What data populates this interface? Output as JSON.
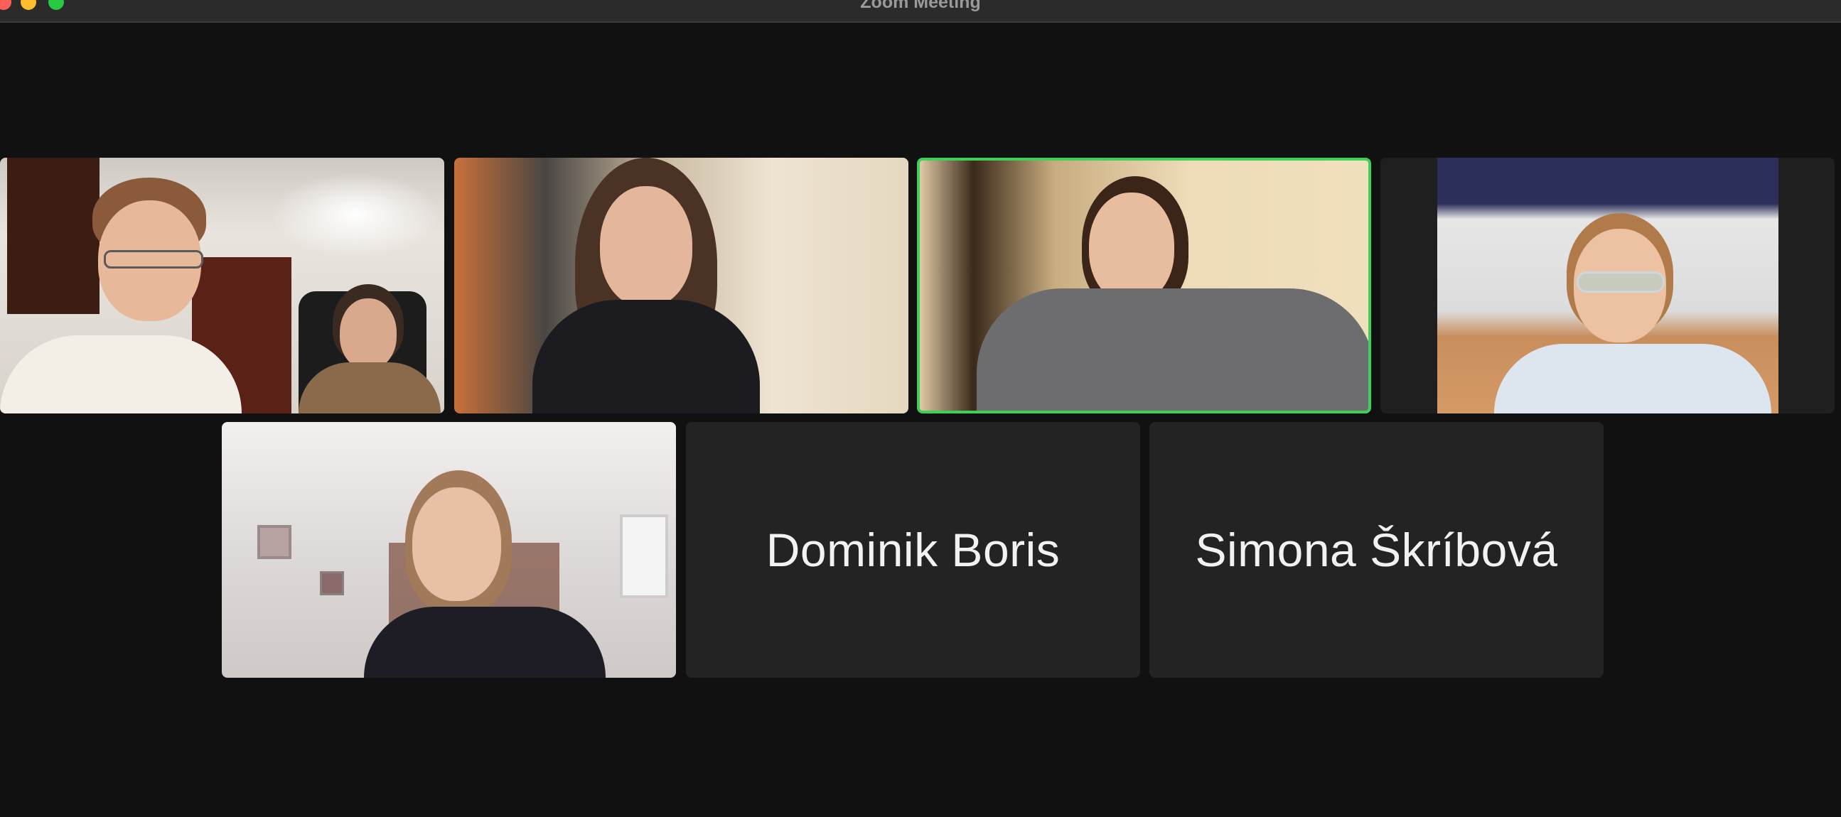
{
  "window": {
    "title": "Zoom Meeting"
  },
  "participants": [
    {
      "id": "tile-1",
      "video": true,
      "speaking": false,
      "name": ""
    },
    {
      "id": "tile-2",
      "video": true,
      "speaking": false,
      "name": ""
    },
    {
      "id": "tile-3",
      "video": true,
      "speaking": true,
      "name": ""
    },
    {
      "id": "tile-4",
      "video": true,
      "speaking": false,
      "name": ""
    },
    {
      "id": "tile-5",
      "video": true,
      "speaking": false,
      "name": ""
    },
    {
      "id": "tile-6",
      "video": false,
      "speaking": false,
      "name": "Dominik Boris"
    },
    {
      "id": "tile-7",
      "video": false,
      "speaking": false,
      "name": "Simona Škríbová"
    }
  ],
  "colors": {
    "background": "#111111",
    "titlebar": "#2b2b2b",
    "tile_placeholder": "#232323",
    "active_speaker_border": "#3fd05a",
    "traffic_close": "#fe5f57",
    "traffic_minimize": "#febc2e",
    "traffic_maximize": "#28c840"
  }
}
